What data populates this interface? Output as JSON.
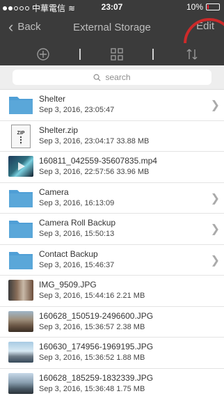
{
  "status": {
    "carrier": "中華電信",
    "time": "23:07",
    "battery": "10%",
    "battery_level": 0.1
  },
  "nav": {
    "back": "Back",
    "title": "External Storage",
    "edit": "Edit"
  },
  "toolbar": {
    "add_icon": "add-icon",
    "grid_icon": "grid-icon",
    "sort_icon": "sort-icon"
  },
  "search": {
    "placeholder": "search"
  },
  "colors": {
    "bar": "#3b3b3b",
    "folder": "#5aa7d9",
    "highlight_circle": "#cc2a2a"
  },
  "files": [
    {
      "name": "Shelter",
      "meta": "Sep 3, 2016, 23:05:47",
      "type": "folder",
      "chevron": true
    },
    {
      "name": "Shelter.zip",
      "meta": "Sep 3, 2016, 23:04:17  33.88 MB",
      "type": "zip",
      "chevron": false
    },
    {
      "name": "160811_042559-35607835.mp4",
      "meta": "Sep 3, 2016, 22:57:56  33.96 MB",
      "type": "video",
      "chevron": false
    },
    {
      "name": "Camera",
      "meta": "Sep 3, 2016, 16:13:09",
      "type": "folder",
      "chevron": true
    },
    {
      "name": "Camera Roll Backup",
      "meta": "Sep 3, 2016, 15:50:13",
      "type": "folder",
      "chevron": true
    },
    {
      "name": "Contact Backup",
      "meta": "Sep 3, 2016, 15:46:37",
      "type": "folder",
      "chevron": true
    },
    {
      "name": "IMG_9509.JPG",
      "meta": "Sep 3, 2016, 15:44:16  2.21 MB",
      "type": "photo",
      "chevron": false
    },
    {
      "name": "160628_150519-2496600.JPG",
      "meta": "Sep 3, 2016, 15:36:57  2.38 MB",
      "type": "photo",
      "chevron": false
    },
    {
      "name": "160630_174956-1969195.JPG",
      "meta": "Sep 3, 2016, 15:36:52  1.88 MB",
      "type": "photo",
      "chevron": false
    },
    {
      "name": "160628_185259-1832339.JPG",
      "meta": "Sep 3, 2016, 15:36:48  1.75 MB",
      "type": "photo",
      "chevron": false
    }
  ]
}
